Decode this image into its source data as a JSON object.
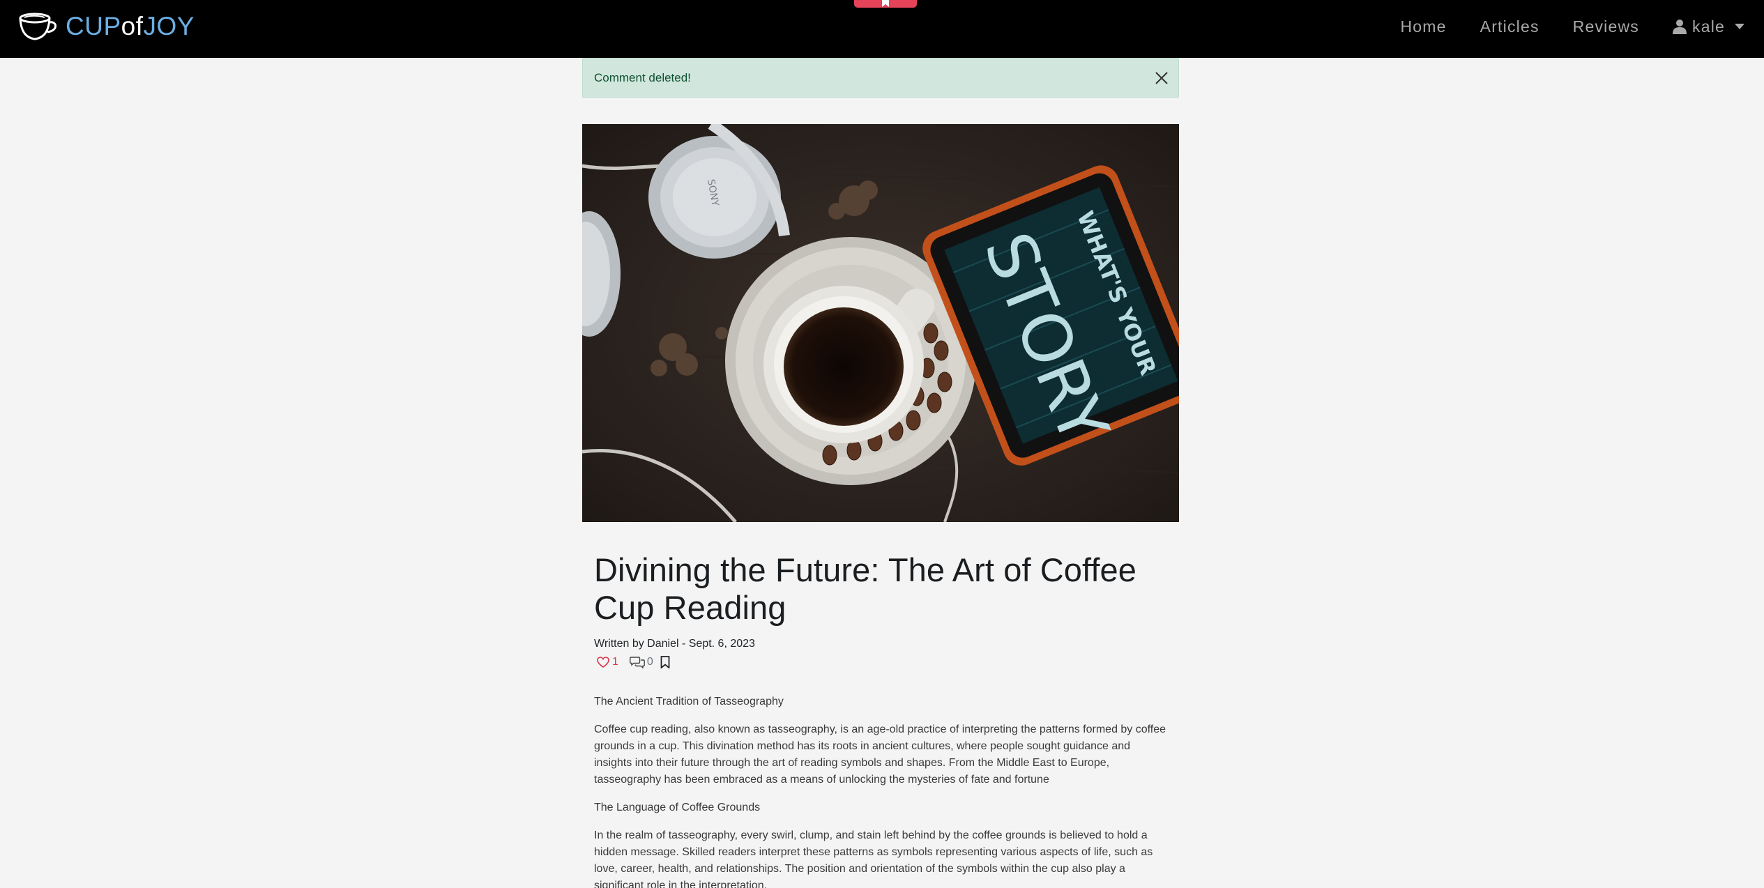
{
  "navbar": {
    "brand": {
      "part1": "CUP",
      "part2": "of",
      "part3": "JOY"
    },
    "links": [
      {
        "label": "Home"
      },
      {
        "label": "Articles"
      },
      {
        "label": "Reviews"
      }
    ],
    "user": {
      "name": "kale",
      "icon": "user-icon"
    },
    "colors": {
      "background": "#000000",
      "brand_accent": "#6aaee4",
      "bookmark_tab": "#e4435a"
    }
  },
  "alert": {
    "message": "Comment deleted!",
    "close_icon": "close-icon",
    "color": "#d1e7dd"
  },
  "hero_image": {
    "tablet_text_line1": "WHAT'S YOUR",
    "tablet_text_line2": "STORY",
    "headphones_brand": "SONY"
  },
  "article": {
    "title": "Divining the Future: The Art of Coffee Cup Reading",
    "byline": "Written by Daniel - Sept. 6, 2023",
    "likes": "1",
    "comments": "0",
    "icons": [
      "heart-icon",
      "comments-icon",
      "bookmark-icon"
    ],
    "sections": [
      {
        "heading": "The Ancient Tradition of Tasseography",
        "text": "Coffee cup reading, also known as tasseography, is an age-old practice of interpreting the patterns formed by coffee grounds in a cup. This divination method has its roots in ancient cultures, where people sought guidance and insights into their future through the art of reading symbols and shapes. From the Middle East to Europe, tasseography has been embraced as a means of unlocking the mysteries of fate and fortune"
      },
      {
        "heading": "The Language of Coffee Grounds",
        "text": "In the realm of tasseography, every swirl, clump, and stain left behind by the coffee grounds is believed to hold a hidden message. Skilled readers interpret these patterns as symbols representing various aspects of life, such as love, career, health, and relationships. The position and orientation of the symbols within the cup also play a significant role in the interpretation."
      }
    ]
  }
}
